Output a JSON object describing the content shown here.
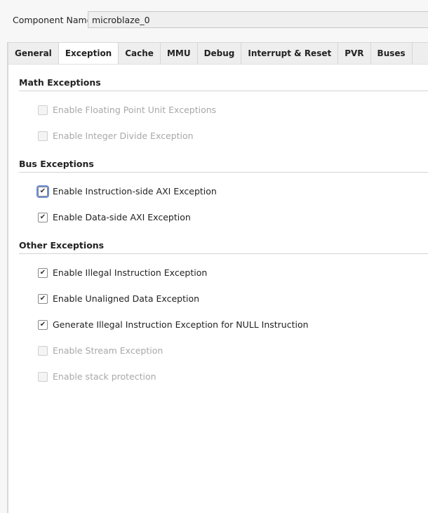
{
  "component_name": {
    "label": "Component Name",
    "value": "microblaze_0"
  },
  "tabs": [
    "General",
    "Exception",
    "Cache",
    "MMU",
    "Debug",
    "Interrupt & Reset",
    "PVR",
    "Buses"
  ],
  "active_tab": "Exception",
  "sections": {
    "math": {
      "title": "Math Exceptions",
      "items": [
        {
          "label": "Enable Floating Point Unit Exceptions",
          "checked": false,
          "enabled": false
        },
        {
          "label": "Enable Integer Divide Exception",
          "checked": false,
          "enabled": false
        }
      ]
    },
    "bus": {
      "title": "Bus Exceptions",
      "items": [
        {
          "label": "Enable Instruction-side AXI Exception",
          "checked": true,
          "enabled": true
        },
        {
          "label": "Enable Data-side AXI Exception",
          "checked": true,
          "enabled": true
        }
      ]
    },
    "other": {
      "title": "Other Exceptions",
      "items": [
        {
          "label": "Enable Illegal Instruction Exception",
          "checked": true,
          "enabled": true
        },
        {
          "label": "Enable Unaligned Data Exception",
          "checked": true,
          "enabled": true
        },
        {
          "label": "Generate Illegal Instruction Exception for NULL Instruction",
          "checked": true,
          "enabled": true
        },
        {
          "label": "Enable Stream Exception",
          "checked": false,
          "enabled": false
        },
        {
          "label": "Enable stack protection",
          "checked": false,
          "enabled": false
        }
      ]
    }
  }
}
